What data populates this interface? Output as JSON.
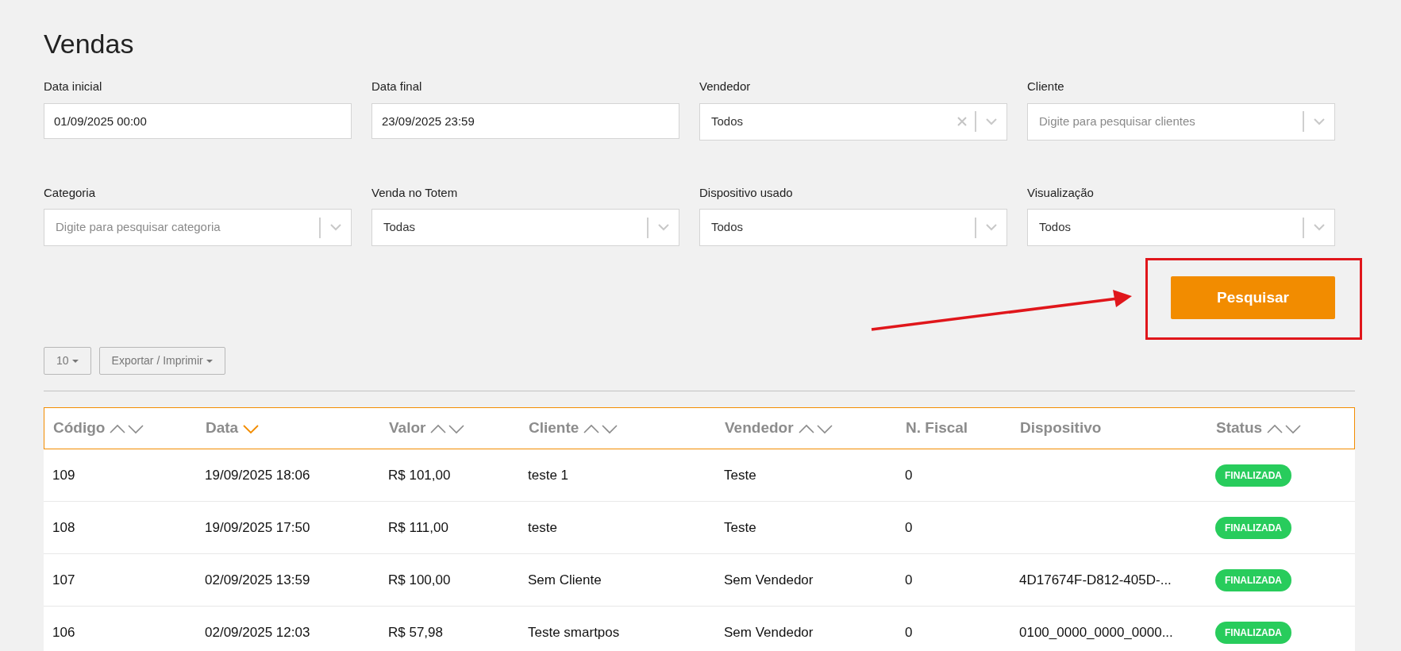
{
  "page": {
    "title": "Vendas"
  },
  "filters": [
    {
      "kind": "text",
      "label": "Data inicial",
      "value": "01/09/2025 00:00"
    },
    {
      "kind": "text",
      "label": "Data final",
      "value": "23/09/2025 23:59"
    },
    {
      "kind": "select",
      "label": "Vendedor",
      "value": "Todos",
      "clearable": true
    },
    {
      "kind": "select",
      "label": "Cliente",
      "placeholder": "Digite para pesquisar clientes",
      "clearable": false
    },
    {
      "kind": "select",
      "label": "Categoria",
      "placeholder": "Digite para pesquisar categoria",
      "clearable": false
    },
    {
      "kind": "select",
      "label": "Venda no Totem",
      "value": "Todas",
      "clearable": false
    },
    {
      "kind": "select",
      "label": "Dispositivo usado",
      "value": "Todos",
      "clearable": false
    },
    {
      "kind": "select",
      "label": "Visualização",
      "value": "Todos",
      "clearable": false
    }
  ],
  "search_button": {
    "label": "Pesquisar",
    "highlighted": true
  },
  "toolbar": {
    "page_size": "10",
    "export": "Exportar / Imprimir"
  },
  "table": {
    "columns": [
      {
        "label": "Código",
        "sortable": true,
        "selected": false
      },
      {
        "label": "Data",
        "sortable": true,
        "selected": true
      },
      {
        "label": "Valor",
        "sortable": true,
        "selected": false
      },
      {
        "label": "Cliente",
        "sortable": true,
        "selected": false
      },
      {
        "label": "Vendedor",
        "sortable": true,
        "selected": false
      },
      {
        "label": "N. Fiscal",
        "sortable": false
      },
      {
        "label": "Dispositivo",
        "sortable": false
      },
      {
        "label": "Status",
        "sortable": true,
        "selected": false
      }
    ],
    "rows": [
      {
        "cells": [
          "109",
          "19/09/2025 18:06",
          "R$ 101,00",
          "teste 1",
          "Teste",
          "0",
          ""
        ],
        "status": "FINALIZADA"
      },
      {
        "cells": [
          "108",
          "19/09/2025 17:50",
          "R$ 111,00",
          "teste",
          "Teste",
          "0",
          ""
        ],
        "status": "FINALIZADA"
      },
      {
        "cells": [
          "107",
          "02/09/2025 13:59",
          "R$ 100,00",
          "Sem Cliente",
          "Sem Vendedor",
          "0",
          "4D17674F-D812-405D-..."
        ],
        "status": "FINALIZADA"
      },
      {
        "cells": [
          "106",
          "02/09/2025 12:03",
          "R$ 57,98",
          "Teste smartpos",
          "Sem Vendedor",
          "0",
          "0100_0000_0000_0000..."
        ],
        "status": "FINALIZADA"
      }
    ]
  }
}
